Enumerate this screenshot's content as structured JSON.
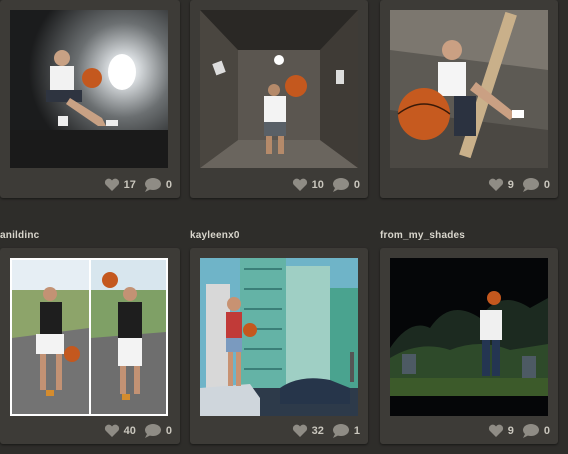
{
  "posts": [
    {
      "username": "",
      "likes": "17",
      "comments": "0"
    },
    {
      "username": "",
      "likes": "10",
      "comments": "0"
    },
    {
      "username": "",
      "likes": "9",
      "comments": "0"
    },
    {
      "username": "anildinc",
      "likes": "40",
      "comments": "0"
    },
    {
      "username": "kayleenx0",
      "likes": "32",
      "comments": "1"
    },
    {
      "username": "from_my_shades",
      "likes": "9",
      "comments": "0"
    }
  ],
  "icons": {
    "like": "heart-icon",
    "comment": "speech-bubble-icon"
  }
}
